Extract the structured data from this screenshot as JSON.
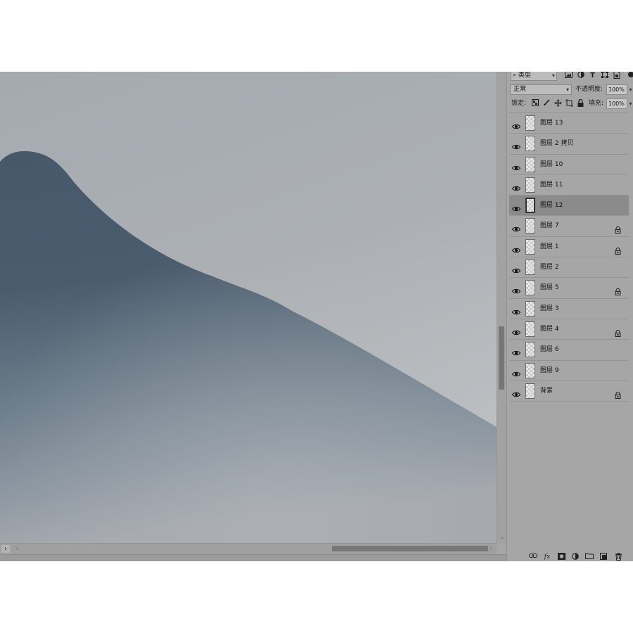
{
  "layers_panel": {
    "filter": {
      "search_icon": "⌕",
      "label": "类型",
      "icons": [
        "image-filter-icon",
        "adjustment-filter-icon",
        "text-filter-icon",
        "shape-filter-icon",
        "smart-object-filter-icon"
      ]
    },
    "blend_mode": "正常",
    "opacity_label": "不透明度:",
    "opacity_value": "100%",
    "lock_label": "锁定:",
    "fill_label": "填充:",
    "fill_value": "100%",
    "layers": [
      {
        "name": "图层 13",
        "visible": true,
        "locked": false,
        "selected": false
      },
      {
        "name": "图层 2 拷贝",
        "visible": true,
        "locked": false,
        "selected": false
      },
      {
        "name": "图层 10",
        "visible": true,
        "locked": false,
        "selected": false
      },
      {
        "name": "图层 11",
        "visible": true,
        "locked": false,
        "selected": false
      },
      {
        "name": "图层 12",
        "visible": true,
        "locked": false,
        "selected": true
      },
      {
        "name": "图层 7",
        "visible": true,
        "locked": true,
        "selected": false
      },
      {
        "name": "图层 1",
        "visible": true,
        "locked": true,
        "selected": false
      },
      {
        "name": "图层 2",
        "visible": true,
        "locked": false,
        "selected": false
      },
      {
        "name": "图层 5",
        "visible": true,
        "locked": true,
        "selected": false
      },
      {
        "name": "图层 3",
        "visible": true,
        "locked": false,
        "selected": false
      },
      {
        "name": "图层 4",
        "visible": true,
        "locked": true,
        "selected": false
      },
      {
        "name": "图层 6",
        "visible": true,
        "locked": false,
        "selected": false
      },
      {
        "name": "图层 9",
        "visible": true,
        "locked": false,
        "selected": false
      },
      {
        "name": "背景",
        "visible": true,
        "locked": true,
        "selected": false
      }
    ],
    "bottom_icons": [
      "link-layers-icon",
      "fx-icon",
      "add-mask-icon",
      "adjustment-layer-icon",
      "new-group-icon",
      "new-layer-icon",
      "trash-icon"
    ]
  },
  "canvas": {
    "sky_color": "#a9aeb3",
    "mountain_color": "#4a5b6c"
  },
  "scroll": {
    "toggle_glyph": "›",
    "left_glyph": "‹",
    "right_glyph": "›",
    "down_glyph": "⌄"
  }
}
